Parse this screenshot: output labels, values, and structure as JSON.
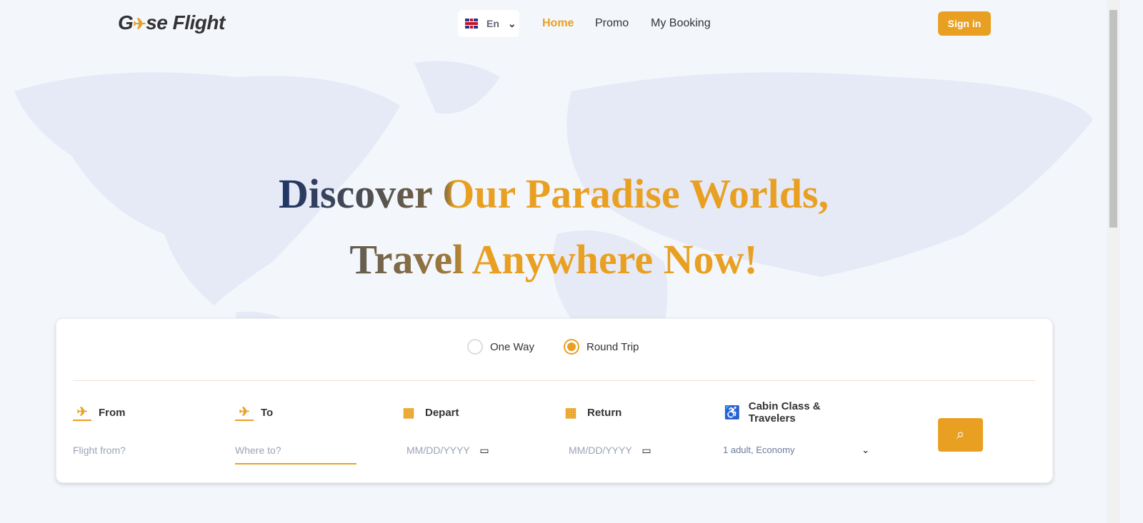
{
  "header": {
    "logo": "Goose Flight",
    "logo_left": "G",
    "logo_right": "se Flight",
    "language": "En",
    "nav": [
      "Home",
      "Promo",
      "My Booking"
    ],
    "signin": "Sign in"
  },
  "hero": {
    "line1": "Discover Our Paradise Worlds,",
    "line2": "Travel Anywhere Now!"
  },
  "search": {
    "trip_types": [
      {
        "label": "One Way",
        "selected": false
      },
      {
        "label": "Round Trip",
        "selected": true
      }
    ],
    "from": {
      "label": "From",
      "placeholder": "Flight from?"
    },
    "to": {
      "label": "To",
      "placeholder": "Where to?"
    },
    "depart": {
      "label": "Depart",
      "placeholder": "MM/DD/YYYY"
    },
    "return": {
      "label": "Return",
      "placeholder": "MM/DD/YYYY"
    },
    "cabin": {
      "label": "Cabin Class & Travelers",
      "value": "1 adult, Economy"
    }
  },
  "colors": {
    "accent": "#e9a022",
    "background": "#f3f6fb"
  }
}
